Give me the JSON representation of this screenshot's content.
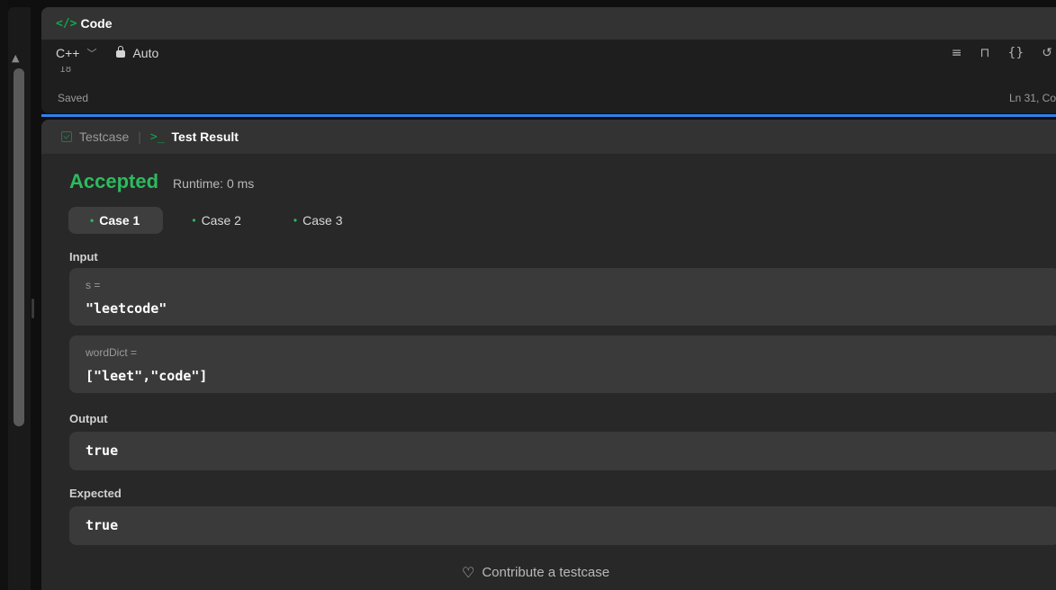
{
  "code_panel": {
    "title": "Code",
    "code_icon": "</>",
    "language": "C++",
    "mode": "Auto",
    "visible_line_number": "18",
    "status": "Saved",
    "cursor_position": "Ln 31, Co",
    "toolbar_icons": [
      "format-icon",
      "bookmark-icon",
      "braces-icon",
      "undo-icon"
    ]
  },
  "test_panel": {
    "tab_testcase": "Testcase",
    "tab_separator": "|",
    "tab_result": "Test Result",
    "terminal_icon": ">_",
    "verdict": "Accepted",
    "runtime": "Runtime: 0 ms",
    "cases": [
      {
        "label": "Case 1",
        "active": true
      },
      {
        "label": "Case 2",
        "active": false
      },
      {
        "label": "Case 3",
        "active": false
      }
    ],
    "input_label": "Input",
    "inputs": [
      {
        "name": "s =",
        "value": "\"leetcode\""
      },
      {
        "name": "wordDict =",
        "value": "[\"leet\",\"code\"]"
      }
    ],
    "output_label": "Output",
    "output_value": "true",
    "expected_label": "Expected",
    "expected_value": "true",
    "contribute_label": "Contribute a testcase"
  },
  "colors": {
    "accepted": "#2cbb5d",
    "accent_divider": "#2f80ed",
    "panel_bg": "#282828"
  }
}
